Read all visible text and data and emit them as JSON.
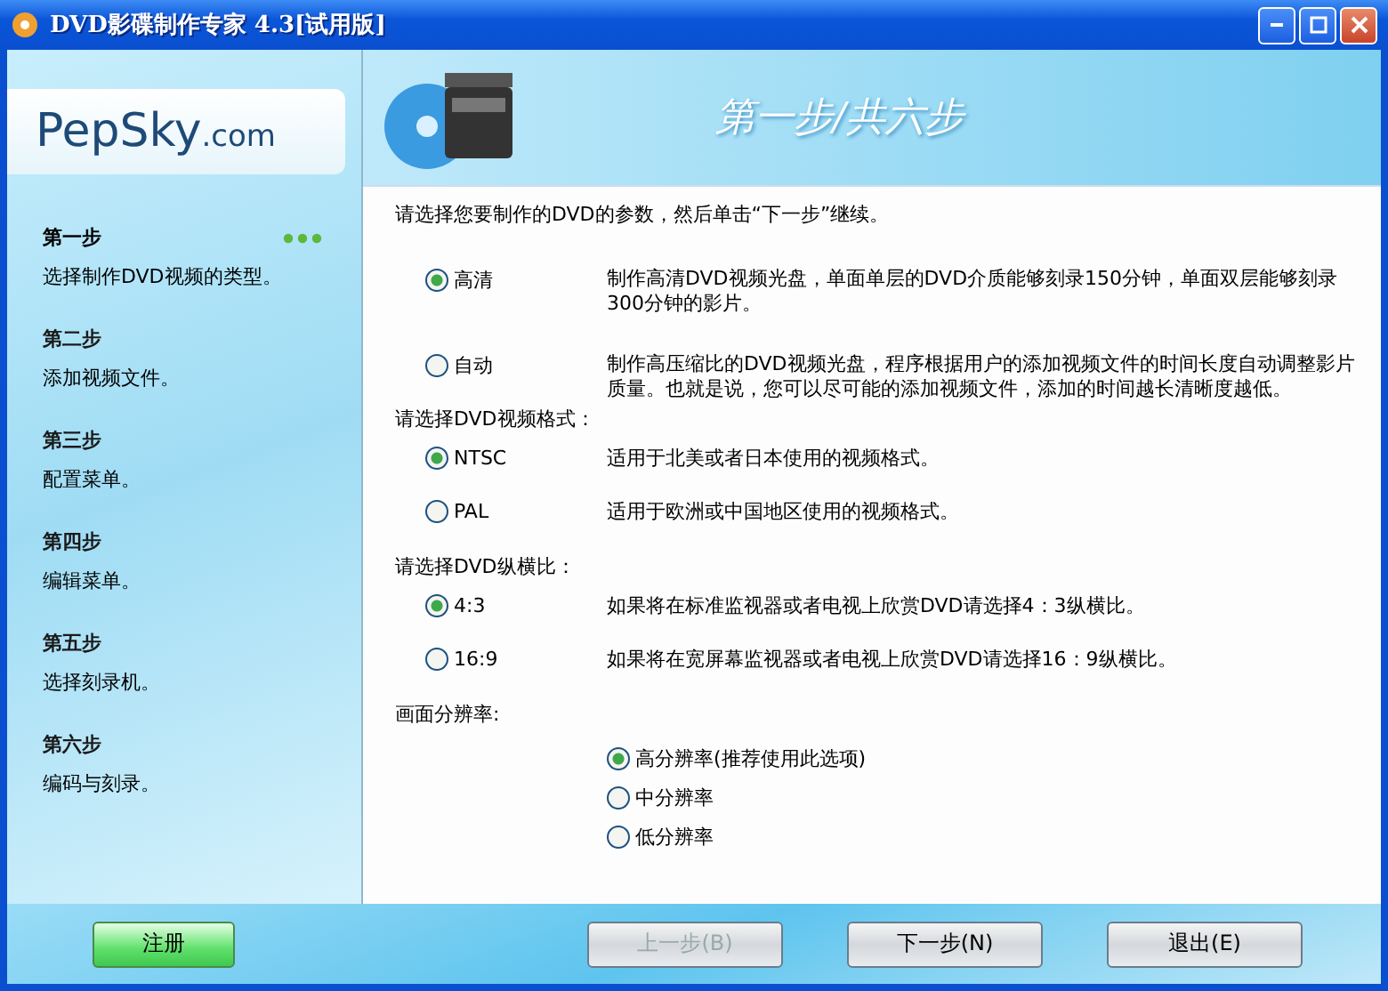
{
  "window": {
    "title": "DVD影碟制作专家 4.3[试用版]"
  },
  "logo": {
    "brand": "PepSky",
    "domain": ".com"
  },
  "banner": {
    "title": "第一步/共六步"
  },
  "steps": [
    {
      "title": "第一步",
      "description": "选择制作DVD视频的类型。",
      "selected": true
    },
    {
      "title": "第二步",
      "description": "添加视频文件。",
      "selected": false
    },
    {
      "title": "第三步",
      "description": "配置菜单。",
      "selected": false
    },
    {
      "title": "第四步",
      "description": "编辑菜单。",
      "selected": false
    },
    {
      "title": "第五步",
      "description": "选择刻录机。",
      "selected": false
    },
    {
      "title": "第六步",
      "description": "编码与刻录。",
      "selected": false
    }
  ],
  "intro": "请选择您要制作的DVD的参数，然后单击“下一步”继续。",
  "groups": [
    {
      "kind": "described",
      "options": [
        {
          "label": "高清",
          "description": "制作高清DVD视频光盘，单面单层的DVD介质能够刻录150分钟，单面双层能够刻录300分钟的影片。",
          "selected": true
        },
        {
          "label": "自动",
          "description": "制作高压缩比的DVD视频光盘，程序根据用户的添加视频文件的时间长度自动调整影片质量。也就是说，您可以尽可能的添加视频文件，添加的时间越长清晰度越低。",
          "selected": false
        }
      ]
    },
    {
      "kind": "described",
      "label": "请选择DVD视频格式：",
      "options": [
        {
          "label": "NTSC",
          "description": "适用于北美或者日本使用的视频格式。",
          "selected": true
        },
        {
          "label": "PAL",
          "description": "适用于欧洲或中国地区使用的视频格式。",
          "selected": false
        }
      ]
    },
    {
      "kind": "described",
      "label": "请选择DVD纵横比：",
      "options": [
        {
          "label": "4:3",
          "description": "如果将在标准监视器或者电视上欣赏DVD请选择4：3纵横比。",
          "selected": true
        },
        {
          "label": "16:9",
          "description": "如果将在宽屏幕监视器或者电视上欣赏DVD请选择16：9纵横比。",
          "selected": false
        }
      ]
    },
    {
      "kind": "plain",
      "label": "画面分辨率:",
      "options": [
        {
          "label": "高分辨率(推荐使用此选项)",
          "selected": true
        },
        {
          "label": "中分辨率",
          "selected": false
        },
        {
          "label": "低分辨率",
          "selected": false
        }
      ]
    }
  ],
  "buttons": [
    {
      "kind": "register",
      "label": "注册",
      "disabled": false
    },
    {
      "kind": "nav",
      "label": "上一步(B)",
      "disabled": true
    },
    {
      "kind": "nav",
      "label": "下一步(N)",
      "disabled": false
    },
    {
      "kind": "nav",
      "label": "退出(E)",
      "disabled": false
    }
  ]
}
